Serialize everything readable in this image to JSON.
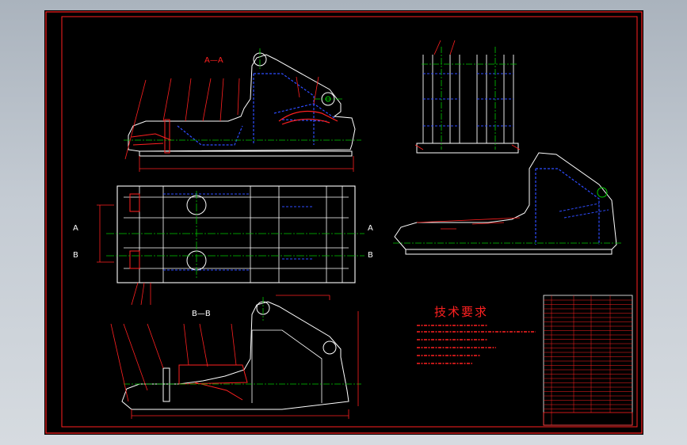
{
  "drawing": {
    "views": {
      "section_a": "A—A",
      "section_b": "B—B",
      "cut_a_left": "A",
      "cut_a_right": "A",
      "cut_b_left": "B",
      "cut_b_right": "B"
    },
    "tech_requirements": {
      "title": "技术要求"
    }
  },
  "colors": {
    "background": "#000000",
    "outline": "#ffffff",
    "hidden": "#2e4cff",
    "center": "#00c800",
    "dimension": "#ff2020",
    "border": "#ff2020"
  }
}
